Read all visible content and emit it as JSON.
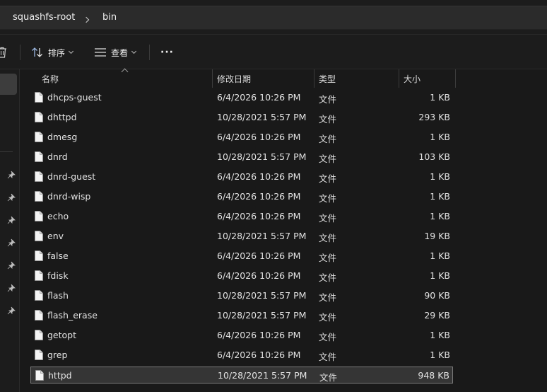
{
  "breadcrumb": [
    "squashfs-root",
    "bin"
  ],
  "toolbar": {
    "sort_label": "排序",
    "view_label": "查看",
    "more_label": "···"
  },
  "columns": {
    "name": "名称",
    "modified": "修改日期",
    "type": "类型",
    "size": "大小"
  },
  "files": [
    {
      "name": "dhcps-guest",
      "modified": "6/4/2026 10:26 PM",
      "type": "文件",
      "size": "1 KB"
    },
    {
      "name": "dhttpd",
      "modified": "10/28/2021 5:57 PM",
      "type": "文件",
      "size": "293 KB"
    },
    {
      "name": "dmesg",
      "modified": "6/4/2026 10:26 PM",
      "type": "文件",
      "size": "1 KB"
    },
    {
      "name": "dnrd",
      "modified": "10/28/2021 5:57 PM",
      "type": "文件",
      "size": "103 KB"
    },
    {
      "name": "dnrd-guest",
      "modified": "6/4/2026 10:26 PM",
      "type": "文件",
      "size": "1 KB"
    },
    {
      "name": "dnrd-wisp",
      "modified": "6/4/2026 10:26 PM",
      "type": "文件",
      "size": "1 KB"
    },
    {
      "name": "echo",
      "modified": "6/4/2026 10:26 PM",
      "type": "文件",
      "size": "1 KB"
    },
    {
      "name": "env",
      "modified": "10/28/2021 5:57 PM",
      "type": "文件",
      "size": "19 KB"
    },
    {
      "name": "false",
      "modified": "6/4/2026 10:26 PM",
      "type": "文件",
      "size": "1 KB"
    },
    {
      "name": "fdisk",
      "modified": "6/4/2026 10:26 PM",
      "type": "文件",
      "size": "1 KB"
    },
    {
      "name": "flash",
      "modified": "10/28/2021 5:57 PM",
      "type": "文件",
      "size": "90 KB"
    },
    {
      "name": "flash_erase",
      "modified": "10/28/2021 5:57 PM",
      "type": "文件",
      "size": "29 KB"
    },
    {
      "name": "getopt",
      "modified": "6/4/2026 10:26 PM",
      "type": "文件",
      "size": "1 KB"
    },
    {
      "name": "grep",
      "modified": "6/4/2026 10:26 PM",
      "type": "文件",
      "size": "1 KB"
    },
    {
      "name": "httpd",
      "modified": "10/28/2021 5:57 PM",
      "type": "文件",
      "size": "948 KB",
      "selected": true
    }
  ]
}
